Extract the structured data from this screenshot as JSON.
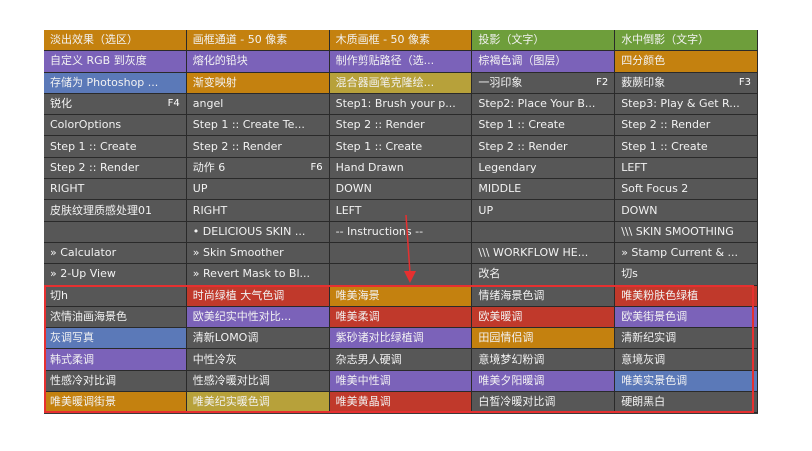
{
  "colors": {
    "gray": "#575757",
    "red": "#c0392b",
    "orange": "#c4810f",
    "yellow": "#b7a13a",
    "green": "#6e9e3b",
    "violet": "#7b62b9",
    "blue": "#5b79b8",
    "highlight": "#e63030"
  },
  "rows": [
    [
      {
        "label": "淡出效果（选区）",
        "color": "orange"
      },
      {
        "label": "画框通道 - 50 像素",
        "color": "orange"
      },
      {
        "label": "木质画框 - 50 像素",
        "color": "orange"
      },
      {
        "label": "投影（文字）",
        "color": "green"
      },
      {
        "label": "水中倒影（文字）",
        "color": "green"
      }
    ],
    [
      {
        "label": "自定义 RGB 到灰度",
        "color": "violet"
      },
      {
        "label": "熔化的铅块",
        "color": "violet"
      },
      {
        "label": "制作剪贴路径（选...",
        "color": "violet"
      },
      {
        "label": "棕褐色调（图层）",
        "color": "violet"
      },
      {
        "label": "四分颜色",
        "color": "orange"
      }
    ],
    [
      {
        "label": "存储为 Photoshop ...",
        "color": "blue"
      },
      {
        "label": "渐变映射",
        "color": "orange"
      },
      {
        "label": "混合器画笔克隆绘...",
        "color": "yellow"
      },
      {
        "label": "一羽印象",
        "key": "F2",
        "color": "gray"
      },
      {
        "label": "薮蕨印象",
        "key": "F3",
        "color": "gray"
      }
    ],
    [
      {
        "label": "锐化",
        "key": "F4",
        "color": "gray"
      },
      {
        "label": "angel",
        "color": "gray"
      },
      {
        "label": "Step1: Brush your p...",
        "color": "gray"
      },
      {
        "label": "Step2: Place Your B...",
        "color": "gray"
      },
      {
        "label": "Step3: Play & Get R...",
        "color": "gray"
      }
    ],
    [
      {
        "label": "ColorOptions",
        "color": "gray"
      },
      {
        "label": "Step 1 :: Create Te...",
        "color": "gray"
      },
      {
        "label": "Step 2 :: Render",
        "color": "gray"
      },
      {
        "label": "Step 1 :: Create",
        "color": "gray"
      },
      {
        "label": "Step 2 :: Render",
        "color": "gray"
      }
    ],
    [
      {
        "label": "Step 1 :: Create",
        "color": "gray"
      },
      {
        "label": "Step 2 :: Render",
        "color": "gray"
      },
      {
        "label": "Step 1 :: Create",
        "color": "gray"
      },
      {
        "label": "Step 2 :: Render",
        "color": "gray"
      },
      {
        "label": "Step 1 :: Create",
        "color": "gray"
      }
    ],
    [
      {
        "label": "Step 2 :: Render",
        "color": "gray"
      },
      {
        "label": "动作 6",
        "key": "F6",
        "color": "gray"
      },
      {
        "label": "Hand Drawn",
        "color": "gray"
      },
      {
        "label": "Legendary",
        "color": "gray"
      },
      {
        "label": "LEFT",
        "color": "gray"
      }
    ],
    [
      {
        "label": "RIGHT",
        "color": "gray"
      },
      {
        "label": "UP",
        "color": "gray"
      },
      {
        "label": "DOWN",
        "color": "gray"
      },
      {
        "label": "MIDDLE",
        "color": "gray"
      },
      {
        "label": "Soft Focus 2",
        "color": "gray"
      }
    ],
    [
      {
        "label": "皮肤纹理质感处理01",
        "color": "gray"
      },
      {
        "label": "RIGHT",
        "color": "gray"
      },
      {
        "label": "LEFT",
        "color": "gray"
      },
      {
        "label": "UP",
        "color": "gray"
      },
      {
        "label": "DOWN",
        "color": "gray"
      }
    ],
    [
      {
        "label": "",
        "color": "gray"
      },
      {
        "label": "• DELICIOUS SKIN ...",
        "color": "gray"
      },
      {
        "label": "-- Instructions --",
        "color": "gray"
      },
      {
        "label": "",
        "color": "gray"
      },
      {
        "label": "\\\\\\ SKIN SMOOTHING",
        "color": "gray"
      }
    ],
    [
      {
        "label": "» Calculator",
        "color": "gray"
      },
      {
        "label": "» Skin Smoother",
        "color": "gray"
      },
      {
        "label": "",
        "color": "gray"
      },
      {
        "label": "\\\\\\ WORKFLOW HE...",
        "color": "gray"
      },
      {
        "label": "» Stamp Current & ...",
        "color": "gray"
      }
    ],
    [
      {
        "label": "» 2-Up View",
        "color": "gray"
      },
      {
        "label": "» Revert Mask to Bl...",
        "color": "gray"
      },
      {
        "label": "",
        "color": "gray"
      },
      {
        "label": "改名",
        "color": "gray"
      },
      {
        "label": "切s",
        "color": "gray"
      }
    ],
    [
      {
        "label": "切h",
        "color": "gray"
      },
      {
        "label": "时尚绿植 大气色调",
        "color": "red"
      },
      {
        "label": "唯美海景",
        "color": "orange"
      },
      {
        "label": "情绪海景色调",
        "color": "gray"
      },
      {
        "label": "唯美粉肤色绿植",
        "color": "red"
      }
    ],
    [
      {
        "label": "浓情油画海景色",
        "color": "gray"
      },
      {
        "label": "欧美纪实中性对比...",
        "color": "violet"
      },
      {
        "label": "唯美柔调",
        "color": "red"
      },
      {
        "label": "欧美暖调",
        "color": "red"
      },
      {
        "label": "欧美街景色调",
        "color": "violet"
      }
    ],
    [
      {
        "label": "灰调写真",
        "color": "blue"
      },
      {
        "label": "清新LOMO调",
        "color": "gray"
      },
      {
        "label": "紫砂诸对比绿植调",
        "color": "violet"
      },
      {
        "label": "田园情侣调",
        "color": "orange"
      },
      {
        "label": "清新纪实调",
        "color": "gray"
      }
    ],
    [
      {
        "label": "韩式柔调",
        "color": "violet"
      },
      {
        "label": "中性冷灰",
        "color": "gray"
      },
      {
        "label": "杂志男人硬调",
        "color": "gray"
      },
      {
        "label": "意境梦幻粉调",
        "color": "gray"
      },
      {
        "label": "意境灰调",
        "color": "gray"
      }
    ],
    [
      {
        "label": "性感冷对比调",
        "color": "gray"
      },
      {
        "label": "性感冷暖对比调",
        "color": "gray"
      },
      {
        "label": "唯美中性调",
        "color": "violet"
      },
      {
        "label": "唯美夕阳暖调",
        "color": "violet"
      },
      {
        "label": "唯美实景色调",
        "color": "blue"
      }
    ],
    [
      {
        "label": "唯美暖调街景",
        "color": "orange"
      },
      {
        "label": "唯美纪实暖色调",
        "color": "yellow"
      },
      {
        "label": "唯美黄晶调",
        "color": "red"
      },
      {
        "label": "白皙冷暖对比调",
        "color": "gray"
      },
      {
        "label": "硬朗黑白",
        "color": "gray"
      }
    ]
  ]
}
